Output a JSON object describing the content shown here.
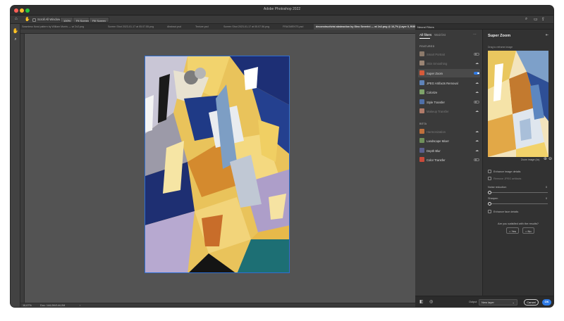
{
  "window": {
    "title": "Adobe Photoshop 2022"
  },
  "options": {
    "scroll_all_windows": "Scroll All Windows",
    "zoom_value": "100%",
    "fit_screen": "Fit Screen",
    "fill_screen": "Fill Screen"
  },
  "tabs": [
    {
      "label": "Seamless floral pattern by William Morris — w/ 2x2.png"
    },
    {
      "label": "Screen Shot 2023-01-17 at 05.07.55.png"
    },
    {
      "label": "Abstract.psd"
    },
    {
      "label": "Texture.psd"
    },
    {
      "label": "Screen Shot 2023-01-17 at 05.07.56.png"
    },
    {
      "label": "FRAGMENTS.psd"
    },
    {
      "label": "deconstructivist abstraction by Gino Severini — w/ 2x2.png @ 16,7% (Layer 0, RGB/16) *"
    }
  ],
  "status": {
    "zoom": "16,67%",
    "doc": "Doc: 144,0M/144,0M"
  },
  "neural_filters": {
    "panel_title": "Neural Filters",
    "tab_all": "All filters",
    "tab_wait": "Wait list",
    "section_featured": "FEATURED",
    "section_beta": "BETA",
    "featured": [
      {
        "name": "Smart Portrait",
        "control": "toggle",
        "state": "off"
      },
      {
        "name": "Skin Smoothing",
        "control": "cloud",
        "state": "off"
      },
      {
        "name": "Super Zoom",
        "control": "toggle",
        "state": "on"
      },
      {
        "name": "JPEG Artifacts Removal",
        "control": "cloud",
        "state": "off"
      },
      {
        "name": "Colorize",
        "control": "cloud",
        "state": "off"
      },
      {
        "name": "Style Transfer",
        "control": "toggle",
        "state": "off"
      },
      {
        "name": "Makeup Transfer",
        "control": "cloud",
        "state": "off"
      }
    ],
    "beta": [
      {
        "name": "Harmonization",
        "control": "cloud",
        "state": "off"
      },
      {
        "name": "Landscape Mixer",
        "control": "cloud",
        "state": "off"
      },
      {
        "name": "Depth Blur",
        "control": "cloud",
        "state": "off"
      },
      {
        "name": "Color Transfer",
        "control": "toggle",
        "state": "off"
      }
    ]
  },
  "detail": {
    "title": "Super Zoom",
    "drag_hint": "Drag to reframe image",
    "zoom_label": "Zoom image (4x)",
    "enhance_details": "Enhance image details",
    "remove_jpeg": "Remove JPEG artifacts",
    "noise_label": "Noise reduction",
    "noise_value": "0",
    "noise_level": 0,
    "sharpen_label": "Sharpen",
    "sharpen_value": "0",
    "sharpen_level": 0,
    "face_details": "Enhance face details",
    "question": "Are you satisfied with the results?",
    "yes": "Yes",
    "no": "No"
  },
  "bottom": {
    "output_label": "Output",
    "output_value": "New layer",
    "cancel": "Cancel",
    "ok": "OK"
  },
  "colors": {
    "accent": "#2f7ae5",
    "selection": "#2f6fd1"
  }
}
